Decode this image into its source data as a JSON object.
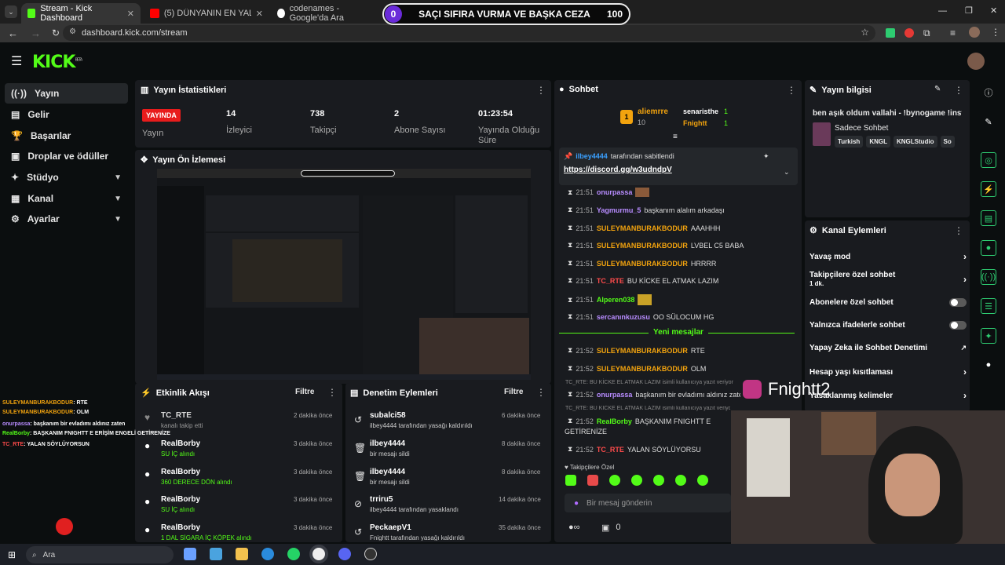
{
  "browser": {
    "tabs": [
      {
        "label": "Stream - Kick Dashboard",
        "color": "#53fc18"
      },
      {
        "label": "(5) DÜNYANIN EN YALNIZ EVİN",
        "color": "#ff0000"
      },
      {
        "label": "codenames - Google'da Ara",
        "color": "#4285f4"
      }
    ],
    "url": "dashboard.kick.com/stream"
  },
  "banner": {
    "left": "0",
    "text": "SAÇI SIFIRA VURMA VE BAŞKA CEZA",
    "right": "100"
  },
  "brand": {
    "logo": "KICK",
    "beta": "BETA"
  },
  "sidebar": {
    "items": [
      {
        "label": "Yayın",
        "icon": "live-icon"
      },
      {
        "label": "Gelir",
        "icon": "revenue-icon"
      },
      {
        "label": "Başarılar",
        "icon": "trophy-icon"
      },
      {
        "label": "Droplar ve ödüller",
        "icon": "gift-icon"
      },
      {
        "label": "Stüdyo",
        "icon": "grid-icon"
      },
      {
        "label": "Kanal",
        "icon": "channel-icon"
      },
      {
        "label": "Ayarlar",
        "icon": "gear-icon"
      }
    ]
  },
  "stats": {
    "title": "Yayın İstatistikleri",
    "live_badge": "YAYINDA",
    "live_label": "Yayın",
    "viewers": {
      "value": "14",
      "label": "İzleyici"
    },
    "followers": {
      "value": "738",
      "label": "Takipçi"
    },
    "subs": {
      "value": "2",
      "label": "Abone Sayısı"
    },
    "uptime": {
      "value": "01:23:54",
      "label1": "Yayında Olduğu",
      "label2": "Süre"
    }
  },
  "preview": {
    "title": "Yayın Ön İzlemesi"
  },
  "chat": {
    "title": "Sohbet",
    "top": [
      {
        "name": "aliemrre",
        "count": "10"
      },
      {
        "name": "senaristhe",
        "count": "1"
      },
      {
        "name": "Fnightt",
        "count": "1"
      }
    ],
    "pinned_by": "ilbey4444",
    "pinned_suffix": "tarafından sabitlendi",
    "pinned_link": "https://discord.gg/w3udndpV",
    "messages": [
      {
        "time": "21:51",
        "user": "onurpassa",
        "text": ""
      },
      {
        "time": "21:51",
        "user": "Yagmurmu_5",
        "text": "başkanım alalım arkadaşı"
      },
      {
        "time": "21:51",
        "user": "SULEYMANBURAKBODUR",
        "text": "AAAHHH"
      },
      {
        "time": "21:51",
        "user": "SULEYMANBURAKBODUR",
        "text": "LVBEL C5 BABA"
      },
      {
        "time": "21:51",
        "user": "SULEYMANBURAKBODUR",
        "text": "HRRRR"
      },
      {
        "time": "21:51",
        "user": "TC_RTE",
        "text": "BU KİCKE EL ATMAK LAZIM"
      },
      {
        "time": "21:51",
        "user": "Alperen038",
        "text": ""
      },
      {
        "time": "21:51",
        "user": "sercanınkuzusu",
        "text": "OO SÜLOCUM HG"
      }
    ],
    "new_messages": "Yeni mesajlar",
    "messages2": [
      {
        "time": "21:52",
        "user": "SULEYMANBURAKBODUR",
        "text": "RTE"
      },
      {
        "time": "21:52",
        "user": "SULEYMANBURAKBODUR",
        "text": "OLM"
      }
    ],
    "sys1": "TC_RTE: BU KİCKE EL ATMAK LAZIM isimli kullanıcıya yazıt veriyor",
    "msg_onur": {
      "time": "21:52",
      "user": "onurpassa",
      "text": "başkanım bir evladımı aldınız zaten"
    },
    "sys2": "TC_RTE: BU KİCKE EL ATMAK LAZIM isimli kullanıcıya yazıt veriyor",
    "msg_realborby": {
      "time": "21:52",
      "user": "RealBorby",
      "text": "BAŞKANIM FNIGHTT E",
      "text2": "GETİRENİZE"
    },
    "msg_tc": {
      "time": "21:52",
      "user": "TC_RTE",
      "text": "YALAN SÖYLÜYORSU"
    },
    "followers_only": "Takipçilere Özel",
    "input_placeholder": "Bir mesaj gönderin",
    "footer_count": "0"
  },
  "stream_info": {
    "title": "Yayın bilgisi",
    "stream_title": "ben aşık oldum vallahi - !bynogame !insta",
    "category": "Sadece Sohbet",
    "tags": [
      "Turkish",
      "KNGL",
      "KNGLStudio",
      "So"
    ]
  },
  "channel_actions": {
    "title": "Kanal Eylemleri",
    "items": [
      {
        "label": "Yavaş mod",
        "sub": "",
        "control": "arrow"
      },
      {
        "label": "Takipçilere özel sohbet",
        "sub": "1 dk.",
        "control": "arrow"
      },
      {
        "label": "Abonelere özel sohbet",
        "sub": "",
        "control": "toggle"
      },
      {
        "label": "Yalnızca ifadelerle sohbet",
        "sub": "",
        "control": "toggle"
      },
      {
        "label": "Yapay Zeka ile Sohbet Denetimi",
        "sub": "",
        "control": "external"
      },
      {
        "label": "Hesap yaşı kısıtlaması",
        "sub": "",
        "control": "arrow"
      },
      {
        "label": "Yasaklanmış kelimeler",
        "sub": "",
        "control": "arrow"
      }
    ]
  },
  "activity": {
    "title": "Etkinlik Akışı",
    "filter": "Filtre",
    "items": [
      {
        "name": "TC_RTE",
        "sub": "kanalı takip etti",
        "time": "2 dakika önce"
      },
      {
        "name": "RealBorby",
        "sub": "SU İÇ alındı",
        "time": "3 dakika önce"
      },
      {
        "name": "RealBorby",
        "sub": "360 DERECE DÖN alındı",
        "time": "3 dakika önce"
      },
      {
        "name": "RealBorby",
        "sub": "SU İÇ alındı",
        "time": "3 dakika önce"
      },
      {
        "name": "RealBorby",
        "sub": "1 DAL SİGARA İÇ KÖPEK alındı",
        "time": "3 dakika önce"
      }
    ]
  },
  "moderation": {
    "title": "Denetim Eylemleri",
    "filter": "Filtre",
    "items": [
      {
        "name": "subalci58",
        "sub": "ilbey4444 tarafından yasağı kaldırıldı",
        "time": "6 dakika önce"
      },
      {
        "name": "ilbey4444",
        "sub": "bir mesajı sildi",
        "time": "8 dakika önce"
      },
      {
        "name": "ilbey4444",
        "sub": "bir mesajı sildi",
        "time": "8 dakika önce"
      },
      {
        "name": "trriru5",
        "sub": "ilbey4444 tarafından yasaklandı",
        "time": "14 dakika önce"
      },
      {
        "name": "PeckaepV1",
        "sub": "Fnightt tarafından yasağı kaldırıldı",
        "time": "35 dakika önce"
      }
    ]
  },
  "overlay_chat": [
    {
      "user": "SULEYMANBURAKBODUR",
      "text": ": RTE"
    },
    {
      "user": "SULEYMANBURAKBODUR",
      "text": ": OLM"
    },
    {
      "user": "onurpassa",
      "text": ": başkanım bir evladımı aldınız zaten"
    },
    {
      "user": "RealBorby",
      "text": ": BAŞKANIM FNIGHTT E ERİŞİM ENGELİ GETİRENİZE"
    },
    {
      "user": "TC_RTE",
      "text": ": YALAN SÖYLÜYORSUN"
    }
  ],
  "instagram_handle": "Fnightt2",
  "taskbar": {
    "search": "Ara"
  },
  "colors": {
    "accent": "#53fc18",
    "live": "#e81c1c",
    "panel": "#191b1f"
  }
}
